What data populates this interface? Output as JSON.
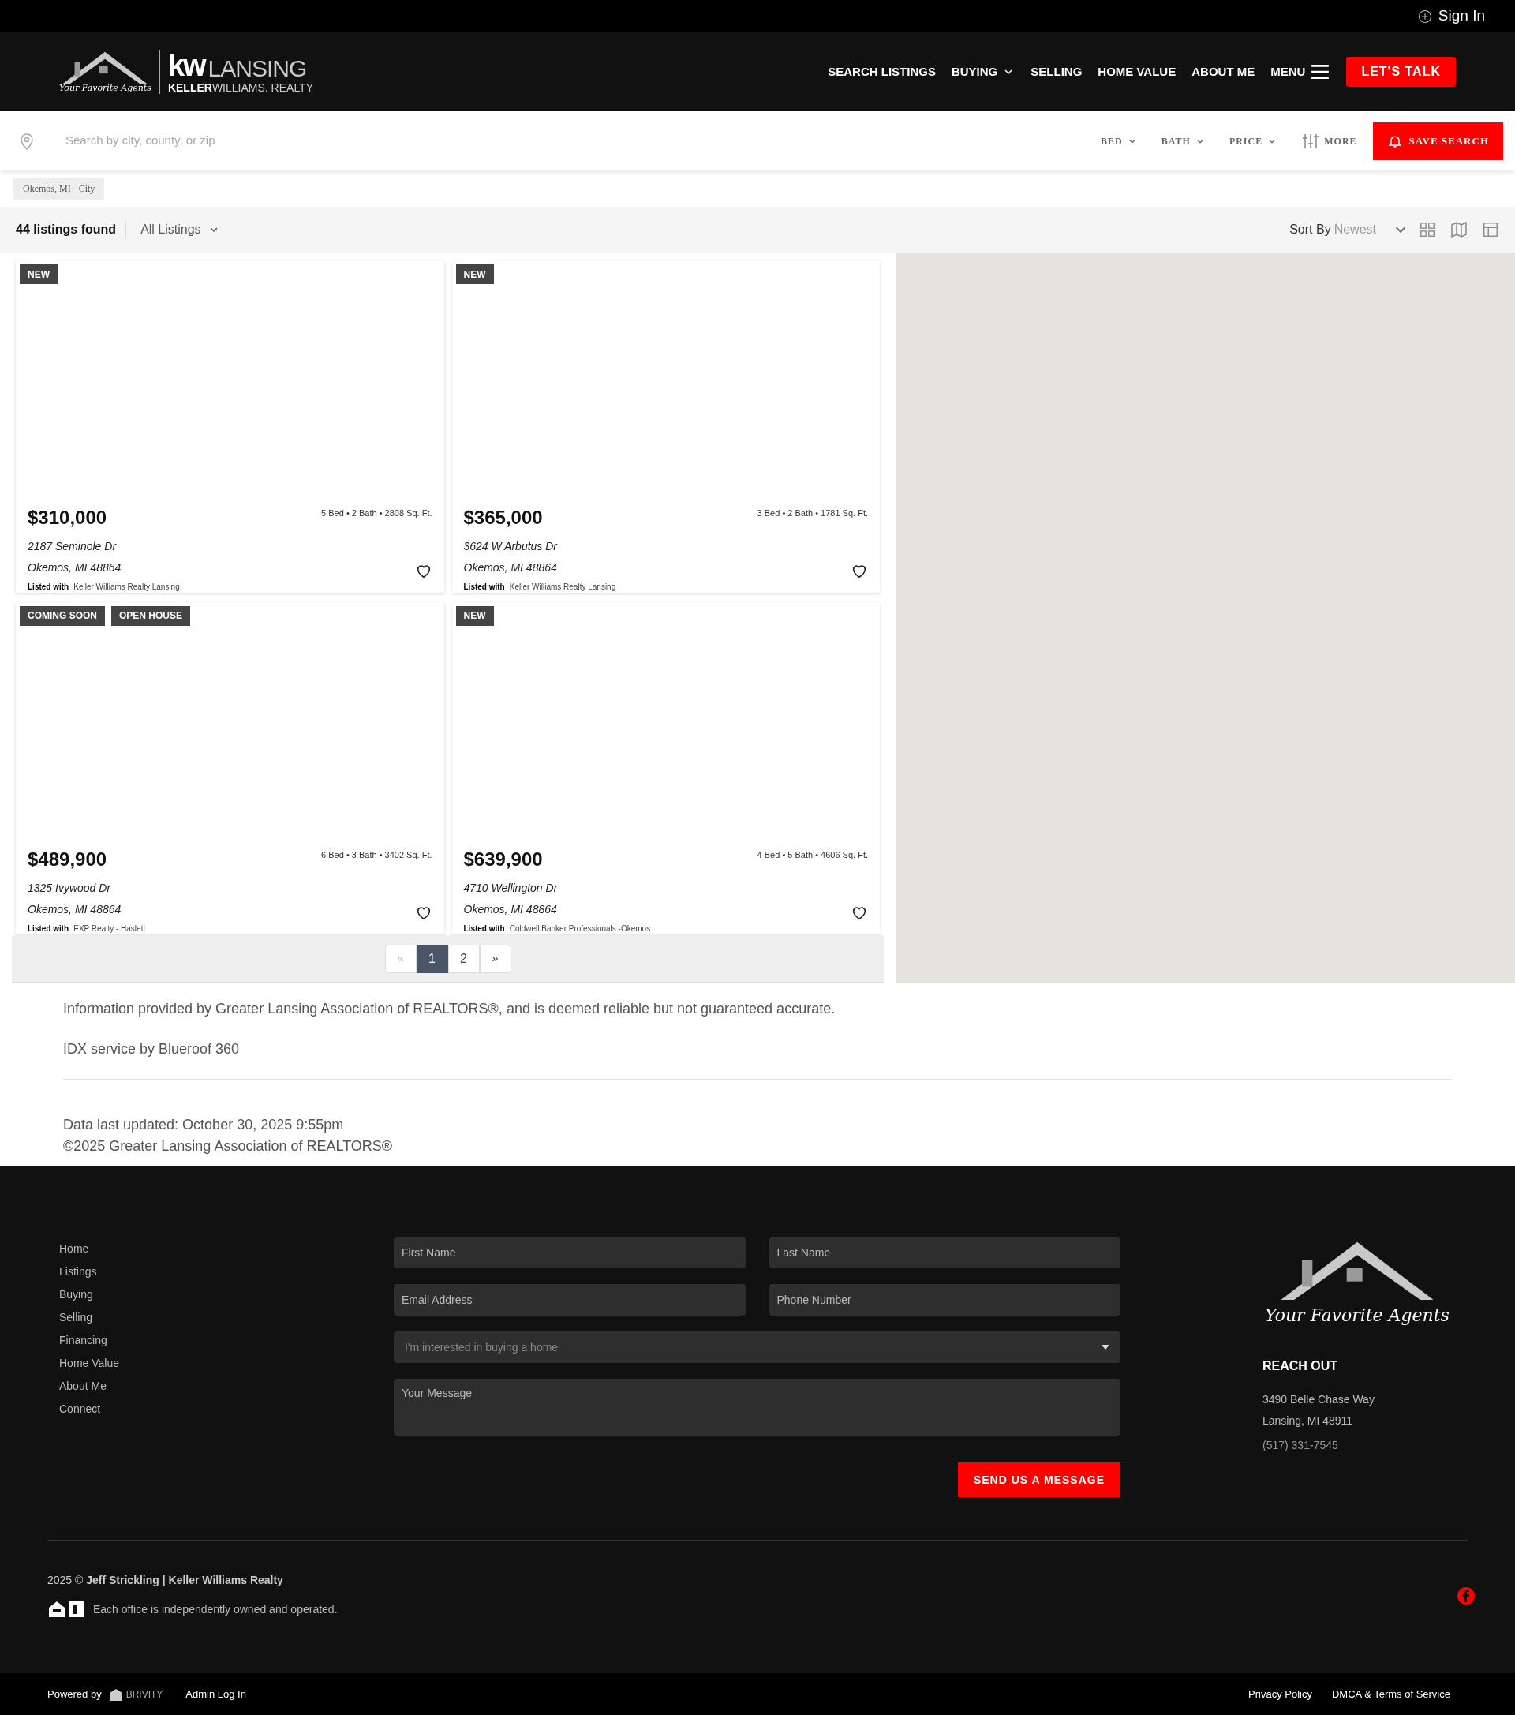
{
  "top_bar": {
    "sign_in": "Sign In"
  },
  "header": {
    "logo": {
      "script": "Your Favorite Agents",
      "kw": "kw",
      "city": "LANSING",
      "brand_bold": "KELLER",
      "brand_rest": "WILLIAMS. REALTY"
    },
    "nav": [
      {
        "label": "SEARCH LISTINGS",
        "kind": "link"
      },
      {
        "label": "BUYING",
        "kind": "dropdown"
      },
      {
        "label": "SELLING",
        "kind": "link"
      },
      {
        "label": "HOME VALUE",
        "kind": "link"
      },
      {
        "label": "ABOUT ME",
        "kind": "link"
      },
      {
        "label": "MENU",
        "kind": "menu"
      }
    ],
    "cta": "LET'S TALK"
  },
  "search": {
    "placeholder": "Search by city, county, or zip",
    "filters": [
      {
        "label": "BED",
        "kind": "dropdown"
      },
      {
        "label": "BATH",
        "kind": "dropdown"
      },
      {
        "label": "PRICE",
        "kind": "dropdown"
      },
      {
        "label": "MORE",
        "kind": "more"
      }
    ],
    "save": "SAVE SEARCH"
  },
  "chips": [
    "Okemos, MI - City"
  ],
  "results": {
    "count": "44 listings found",
    "type_filter": "All Listings",
    "sort_label": "Sort By",
    "sort_value": "Newest"
  },
  "listings": [
    {
      "badges": [
        "NEW"
      ],
      "price": "$310,000",
      "specs": "5 Bed • 2 Bath • 2808 Sq. Ft.",
      "address1": "2187 Seminole Dr",
      "address2": "Okemos, MI 48864",
      "listed_label": "Listed with",
      "broker": "Keller Williams Realty Lansing"
    },
    {
      "badges": [
        "NEW"
      ],
      "price": "$365,000",
      "specs": "3 Bed • 2 Bath • 1781 Sq. Ft.",
      "address1": "3624 W Arbutus Dr",
      "address2": "Okemos, MI 48864",
      "listed_label": "Listed with",
      "broker": "Keller Williams Realty Lansing"
    },
    {
      "badges": [
        "COMING SOON",
        "OPEN HOUSE"
      ],
      "price": "$489,900",
      "specs": "6 Bed • 3 Bath • 3402 Sq. Ft.",
      "address1": "1325 Ivywood Dr",
      "address2": "Okemos, MI 48864",
      "listed_label": "Listed with",
      "broker": "EXP Realty - Haslett"
    },
    {
      "badges": [
        "NEW"
      ],
      "price": "$639,900",
      "specs": "4 Bed • 5 Bath • 4606 Sq. Ft.",
      "address1": "4710 Wellington Dr",
      "address2": "Okemos, MI 48864",
      "listed_label": "Listed with",
      "broker": "Coldwell Banker Professionals -Okemos"
    }
  ],
  "pagination": {
    "prev": {
      "label": "«",
      "disabled": true
    },
    "pages": [
      {
        "label": "1",
        "selected": true
      },
      {
        "label": "2",
        "selected": false
      }
    ],
    "next": {
      "label": "»",
      "disabled": false
    }
  },
  "info": {
    "paragraphs": [
      "Information provided by Greater Lansing Association of REALTORS®, and is deemed reliable but not guaranteed accurate.",
      "IDX service by Blueroof 360"
    ],
    "updated": "Data last updated: October 30, 2025 9:55pm",
    "copyright": "©2025 Greater Lansing Association of REALTORS®"
  },
  "footer": {
    "links": [
      "Home",
      "Listings",
      "Buying",
      "Selling",
      "Financing",
      "Home Value",
      "About Me",
      "Connect"
    ],
    "form": {
      "fields": [
        {
          "placeholder": "First Name"
        },
        {
          "placeholder": "Last Name"
        },
        {
          "placeholder": "Email Address"
        },
        {
          "placeholder": "Phone Number"
        }
      ],
      "select": "I'm interested in buying a home",
      "message": {
        "placeholder": "Your Message"
      },
      "submit": "SEND US A MESSAGE"
    },
    "logo_script": "Your Favorite Agents",
    "reach_heading": "REACH OUT",
    "address": [
      "3490 Belle Chase Way",
      "Lansing, MI 48911"
    ],
    "phone": "(517) 331-7545",
    "copyright": "2025 © **Jeff Strickling | Keller Williams Realty**",
    "disclaimer": "Each office is independently owned and operated."
  },
  "bottom_bar": {
    "powered": "Powered by",
    "brand": "BRIVITY",
    "admin": "Admin Log In",
    "links": [
      "Privacy Policy",
      "DMCA & Terms of Service"
    ]
  }
}
